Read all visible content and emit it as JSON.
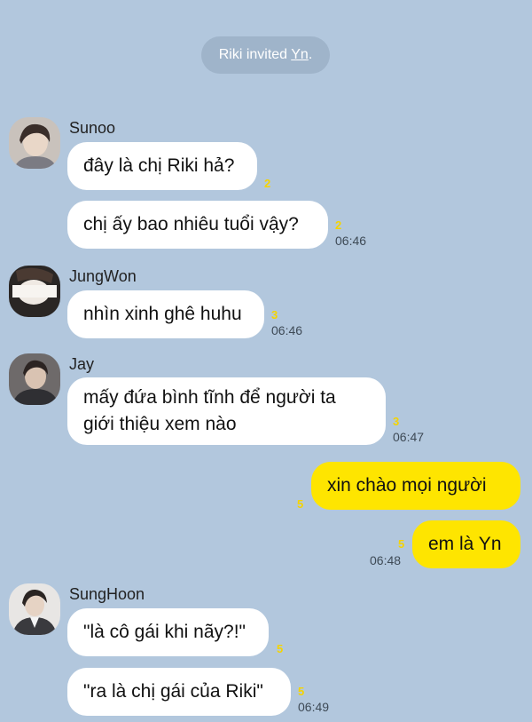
{
  "system_notice": {
    "prefix": "Riki invited ",
    "name": "Yn",
    "suffix": "."
  },
  "messages": [
    {
      "sender": "Sunoo",
      "text": "đây là chị Riki hả?",
      "unread": "2",
      "time": ""
    },
    {
      "sender": "",
      "text": "chị ấy bao nhiêu tuổi vậy?",
      "unread": "2",
      "time": "06:46"
    },
    {
      "sender": "JungWon",
      "text": "nhìn xinh ghê huhu",
      "unread": "3",
      "time": "06:46"
    },
    {
      "sender": "Jay",
      "text": "mấy đứa bình tĩnh để người ta\ngiới thiệu xem nào",
      "unread": "3",
      "time": "06:47"
    },
    {
      "sender": "",
      "text": "xin chào mọi người",
      "unread": "5",
      "time": ""
    },
    {
      "sender": "",
      "text": "em là Yn",
      "unread": "5",
      "time": "06:48"
    },
    {
      "sender": "SungHoon",
      "text": "\"là cô gái khi nãy?!\"",
      "unread": "5",
      "time": ""
    },
    {
      "sender": "",
      "text": "\"ra là chị gái của Riki\"",
      "unread": "5",
      "time": "06:49"
    }
  ],
  "colors": {
    "background": "#b2c7dd",
    "my_bubble": "#fee500",
    "other_bubble": "#ffffff",
    "unread": "#f5d400"
  }
}
